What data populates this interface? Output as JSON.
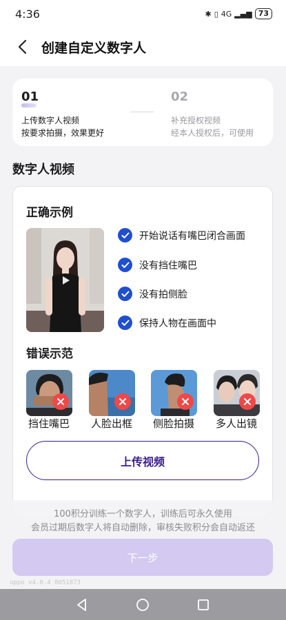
{
  "status_bar": {
    "time": "4:36",
    "signal_label": "4G",
    "battery": "73"
  },
  "header": {
    "title": "创建自定义数字人"
  },
  "steps": [
    {
      "number": "01",
      "title": "上传数字人视频",
      "subtitle": "按要求拍摄，效果更好"
    },
    {
      "number": "02",
      "title": "补充授权视频",
      "subtitle": "经本人授权后，可使用"
    }
  ],
  "section_title": "数字人视频",
  "correct": {
    "heading": "正确示例",
    "checks": [
      "开始说话有嘴巴闭合画面",
      "没有挡住嘴巴",
      "没有拍侧脸",
      "保持人物在画面中"
    ]
  },
  "wrong": {
    "heading": "错误示范",
    "items": [
      {
        "label": "挡住嘴巴"
      },
      {
        "label": "人脸出框"
      },
      {
        "label": "侧脸拍摄"
      },
      {
        "label": "多人出镜"
      }
    ]
  },
  "upload_label": "上传视频",
  "notice": {
    "line1": "100积分训练一个数字人，训练后可永久使用",
    "line2": "会员过期后数字人将自动删除，审核失败积分会自动返还"
  },
  "next_label": "下一步",
  "version": "oppo v4.0.4 8051873",
  "colors": {
    "accent": "#3a1e8c",
    "check": "#1f4fcf",
    "error": "#f04848",
    "next_disabled": "#d3c9f1"
  }
}
